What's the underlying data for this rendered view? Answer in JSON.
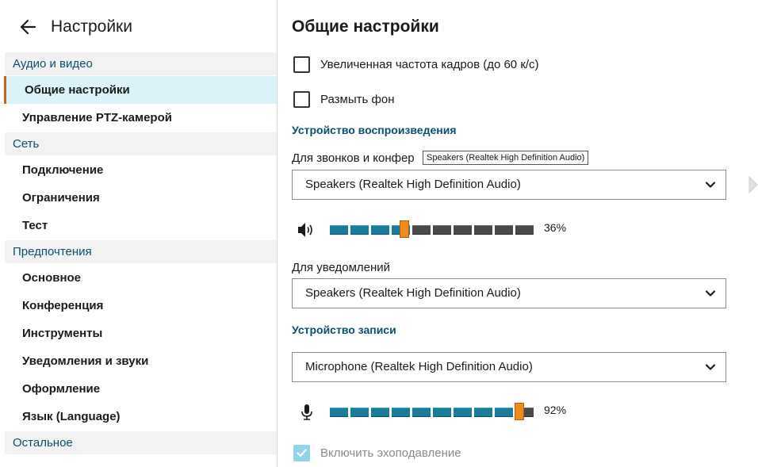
{
  "sidebar": {
    "title": "Настройки",
    "sections": [
      {
        "label": "Аудио и видео",
        "items": [
          {
            "label": "Общие настройки",
            "active": true
          },
          {
            "label": "Управление PTZ-камерой"
          }
        ]
      },
      {
        "label": "Сеть",
        "items": [
          {
            "label": "Подключение"
          },
          {
            "label": "Ограничения"
          },
          {
            "label": "Тест"
          }
        ]
      },
      {
        "label": "Предпочтения",
        "items": [
          {
            "label": "Основное"
          },
          {
            "label": "Конференция"
          },
          {
            "label": "Инструменты"
          },
          {
            "label": "Уведомления и звуки"
          },
          {
            "label": "Оформление"
          },
          {
            "label": "Язык (Language)"
          }
        ]
      },
      {
        "label": "Остальное",
        "items": []
      }
    ]
  },
  "main": {
    "title": "Общие настройки",
    "frame_rate": {
      "label": "Увеличенная частота кадров (до 60 к/с)",
      "checked": false
    },
    "blur": {
      "label": "Размыть фон",
      "checked": false
    },
    "playback": {
      "heading": "Устройство воспроизведения",
      "calls_label": "Для звонков и конфер",
      "calls_device": "Speakers (Realtek High Definition Audio)",
      "tooltip": "Speakers (Realtek High Definition Audio)",
      "volume": 36,
      "volume_text": "36%",
      "notify_label": "Для уведомлений",
      "notify_device": "Speakers (Realtek High Definition Audio)"
    },
    "recording": {
      "heading": "Устройство записи",
      "device": "Microphone (Realtek High Definition Audio)",
      "volume": 92,
      "volume_text": "92%"
    },
    "echo": {
      "label": "Включить эхоподавление",
      "checked": true,
      "disabled": true
    }
  },
  "colors": {
    "accent": "#08506b",
    "active_bg": "#daf4fa",
    "active_border": "#c56a13",
    "slider_on": "#1a7c9a",
    "thumb": "#f08a1c"
  },
  "icons": [
    "back-arrow-icon",
    "chevron-down-icon",
    "speaker-icon",
    "microphone-icon",
    "check-icon"
  ]
}
